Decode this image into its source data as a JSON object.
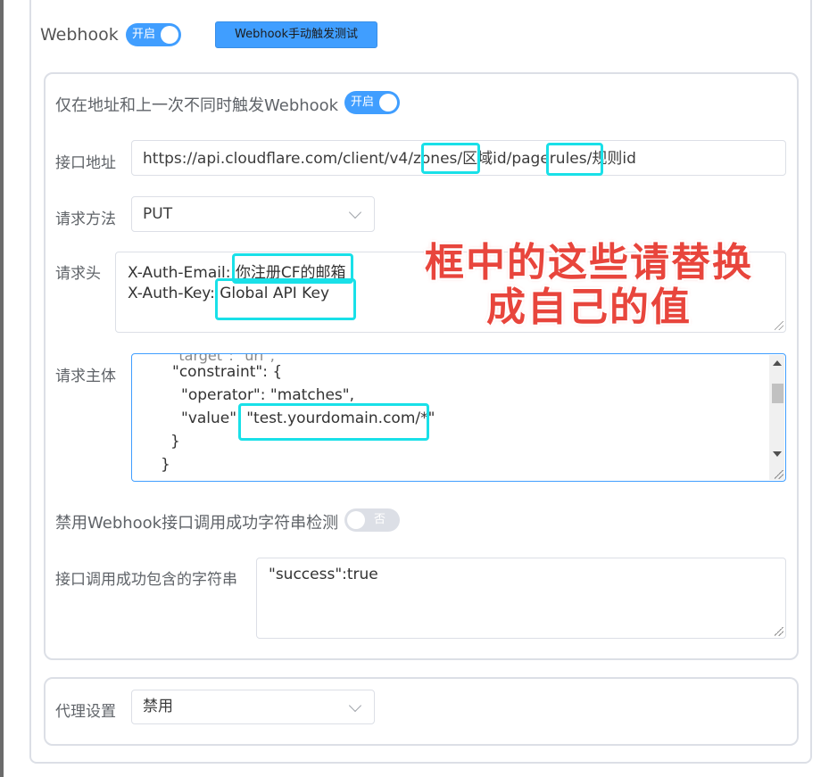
{
  "webhook": {
    "label": "Webhook",
    "switch_text": "开启",
    "test_button": "Webhook手动触发测试"
  },
  "form": {
    "only_changed_label": "仅在地址和上一次不同时触发Webhook",
    "only_changed_switch": "开启",
    "url_label": "接口地址",
    "url_value": "https://api.cloudflare.com/client/v4/zones/区域id/pagerules/规则id",
    "method_label": "请求方法",
    "method_value": "PUT",
    "headers_label": "请求头",
    "headers_line1": "X-Auth-Email: 你注册CF的邮箱",
    "headers_line2": "X-Auth-Key: Global API Key",
    "body_label": "请求主体",
    "body_lines": [
      "\"constraint\": {",
      "\"operator\": \"matches\",",
      "\"value\": \"test.yourdomain.com/*\"",
      "}",
      "}"
    ],
    "disable_check_label": "禁用Webhook接口调用成功字符串检测",
    "disable_check_switch": "否",
    "success_str_label": "接口调用成功包含的字符串",
    "success_str_value": "\"success\":true"
  },
  "proxy": {
    "label": "代理设置",
    "value": "禁用"
  },
  "annotation": {
    "line1": "框中的这些请替换",
    "line2": "成自己的值"
  },
  "colors": {
    "primary": "#409eff",
    "highlight": "#19e0e8",
    "annotation": "#e8453c"
  }
}
